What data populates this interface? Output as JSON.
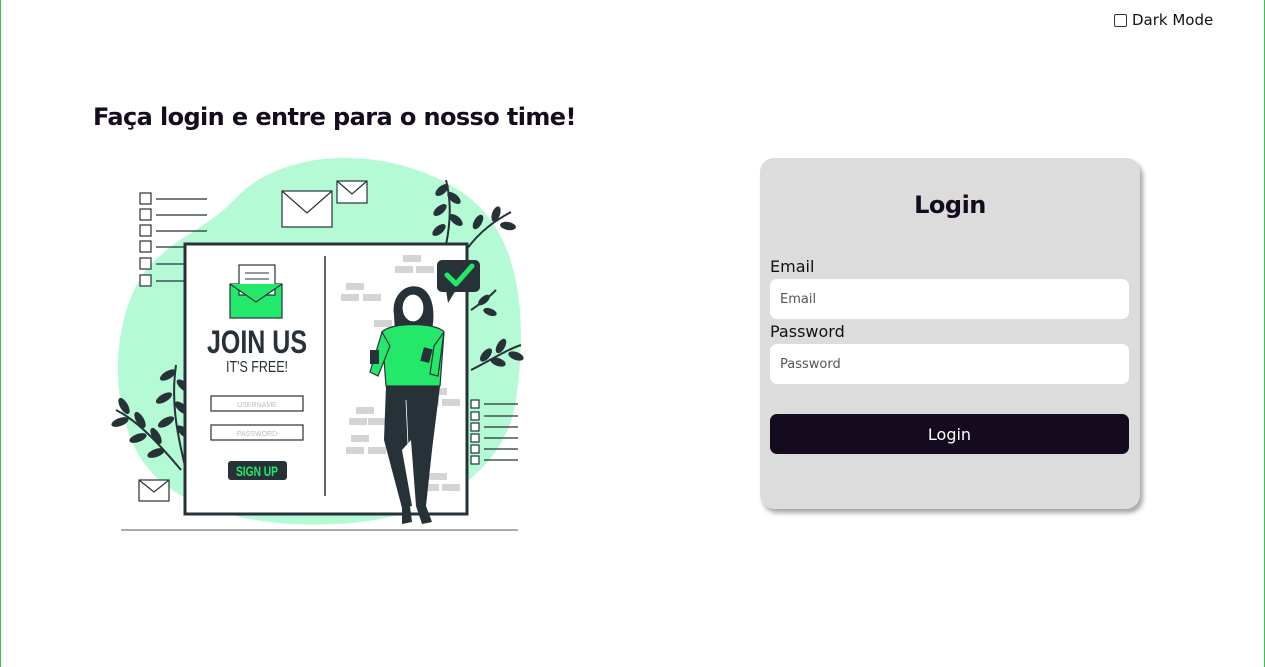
{
  "dark_mode": {
    "label": "Dark Mode",
    "checked": false
  },
  "headline": "Faça login e entre para o nosso time!",
  "illustration": {
    "join_title": "JOIN US",
    "join_subtitle": "IT'S FREE!",
    "username_placeholder": "USERNAME",
    "password_placeholder": "PASSWORD",
    "signup_label": "SIGN UP",
    "colors": {
      "accent": "#24e86a",
      "blob": "#b4fad4",
      "dark": "#263238"
    }
  },
  "login_card": {
    "title": "Login",
    "email_label": "Email",
    "email_placeholder": "Email",
    "email_value": "",
    "password_label": "Password",
    "password_placeholder": "Password",
    "password_value": "",
    "submit_label": "Login"
  },
  "colors": {
    "primary": "#150b1f",
    "card_bg": "#dcdcdc",
    "page_bg": "#ffffff"
  }
}
